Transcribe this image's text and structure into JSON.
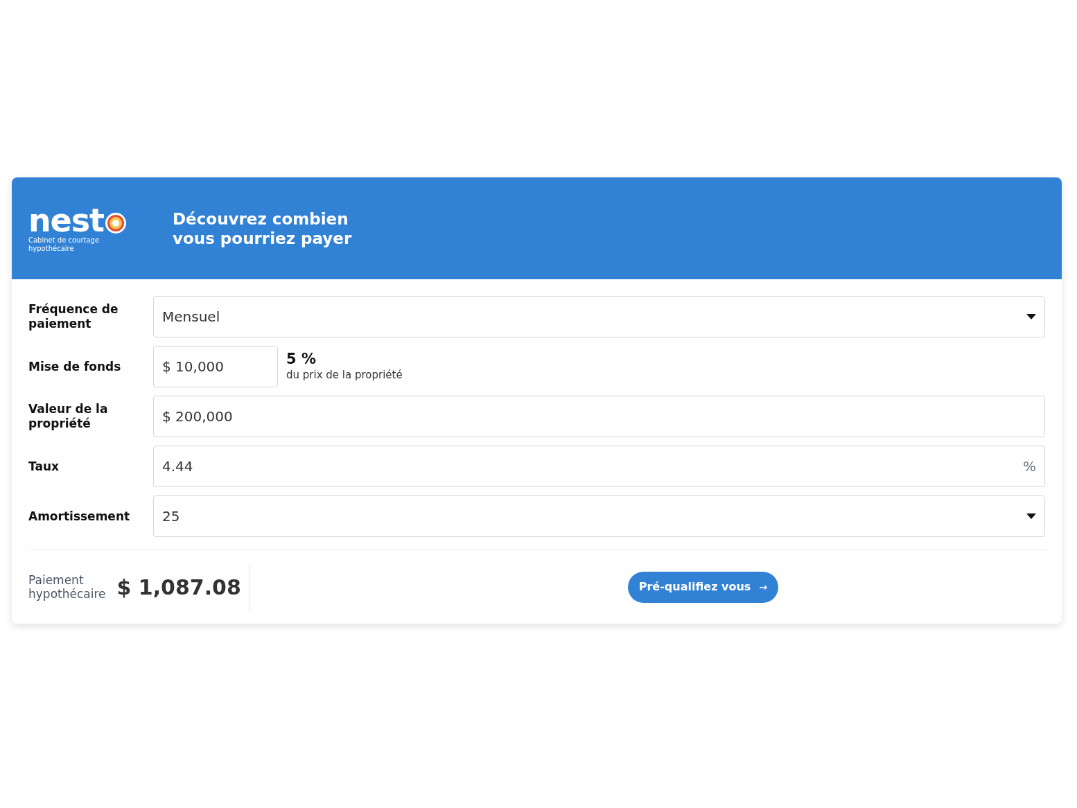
{
  "header": {
    "logo": "nest",
    "tagline": "Cabinet de courtage hypothécaire",
    "title_lines": [
      "Découvrez combien",
      "vous pourriez payer"
    ]
  },
  "fields": [
    {
      "label": "Fréquence de paiement",
      "kind": "select",
      "value": "Mensuel"
    },
    {
      "label": "Mise de fonds",
      "kind": "down_payment",
      "value": "$ 10,000",
      "percent": "5 %",
      "note": "du prix de la propriété"
    },
    {
      "label": "Valeur de la propriété",
      "kind": "input",
      "value": "$ 200,000"
    },
    {
      "label": "Taux",
      "kind": "input",
      "value": "4.44",
      "suffix": "%"
    },
    {
      "label": "Amortissement",
      "kind": "select",
      "value": "25"
    }
  ],
  "result": {
    "label_lines": [
      "Paiement",
      "hypothécaire"
    ],
    "amount": "$ 1,087.08"
  },
  "cta": {
    "label": "Pré-qualifiez vous",
    "icon": "→"
  }
}
